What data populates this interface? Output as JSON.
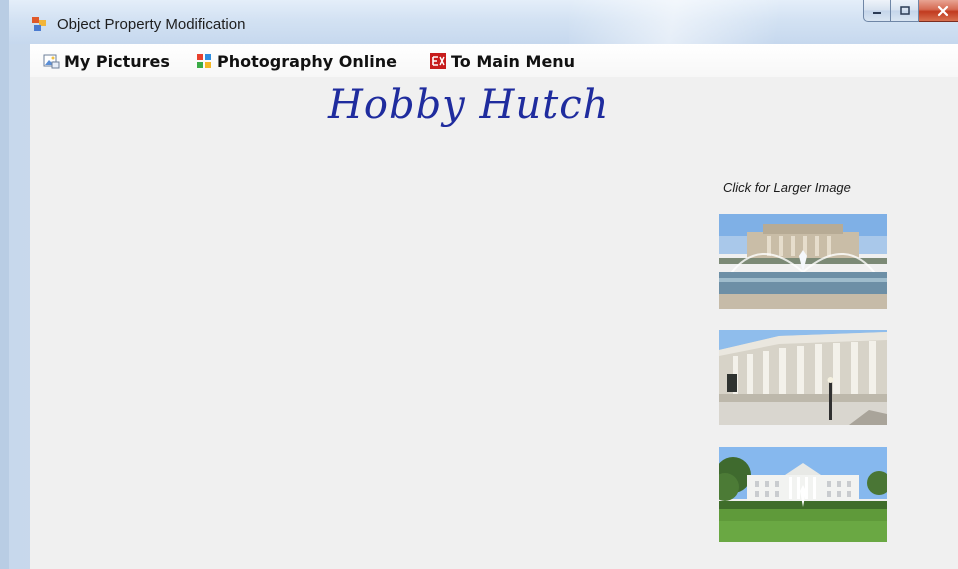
{
  "window": {
    "title": "Object Property Modification"
  },
  "menu": {
    "items": [
      {
        "label": "My Pictures",
        "icon": "pictures-icon"
      },
      {
        "label": "Photography Online",
        "icon": "photography-online-icon"
      },
      {
        "label": "To Main Menu",
        "icon": "exit-icon"
      }
    ]
  },
  "main": {
    "logo_text": "Hobby Hutch",
    "thumbnail_hint": "Click for Larger Image",
    "thumbnails": [
      {
        "icon": "fountain-building-photo"
      },
      {
        "icon": "columned-building-photo"
      },
      {
        "icon": "white-house-photo"
      }
    ]
  },
  "colors": {
    "logo": "#1f2c9e",
    "client_background": "#f0f0f0",
    "close_button": "#c13a1f"
  }
}
